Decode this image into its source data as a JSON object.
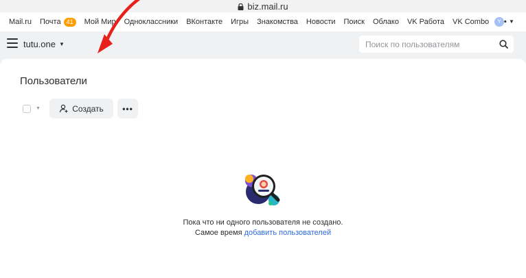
{
  "browser": {
    "url": "biz.mail.ru"
  },
  "portal_menu": {
    "items": [
      {
        "label": "Mail.ru"
      },
      {
        "label": "Почта",
        "badge": "41"
      },
      {
        "label": "Мой Мир"
      },
      {
        "label": "Одноклассники"
      },
      {
        "label": "ВКонтакте"
      },
      {
        "label": "Игры"
      },
      {
        "label": "Знакомства"
      },
      {
        "label": "Новости"
      },
      {
        "label": "Поиск"
      },
      {
        "label": "Облако"
      },
      {
        "label": "VK Работа"
      },
      {
        "label": "VK Combo"
      }
    ],
    "more_label": "•••",
    "avatar_letter": "Y",
    "badge_color": "#ff9e00"
  },
  "header": {
    "domain": "tutu.one",
    "search_placeholder": "Поиск по пользователям"
  },
  "main": {
    "title": "Пользователи",
    "create_label": "Создать",
    "more_label": "•••",
    "annotation_color": "#e8201c",
    "empty": {
      "line1": "Пока что ни одного пользователя не создано.",
      "line2_prefix": "Самое время ",
      "line2_link": "добавить пользователей",
      "link_color": "#2b6ad9"
    }
  }
}
